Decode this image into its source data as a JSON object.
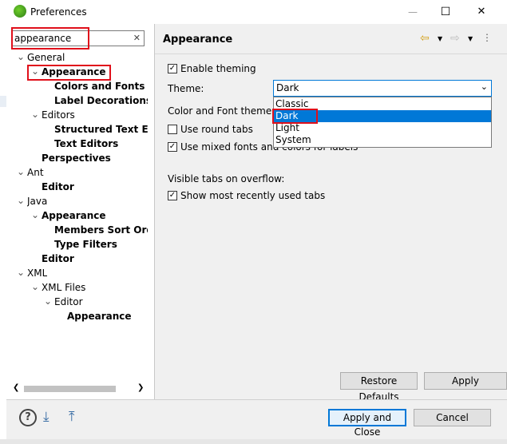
{
  "window": {
    "title": "Preferences",
    "minimize_glyph": "—",
    "maximize_glyph": "☐",
    "close_glyph": "✕",
    "icon": "eclipse-icon"
  },
  "filter": {
    "value": "appearance",
    "clear_glyph": "✕"
  },
  "tree": [
    {
      "label": "General",
      "bold": false
    },
    {
      "label": "Appearance",
      "bold": true
    },
    {
      "label": "Colors and Fonts",
      "bold": true
    },
    {
      "label": "Label Decorations",
      "bold": true
    },
    {
      "label": "Editors",
      "bold": false
    },
    {
      "label": "Structured Text Edi",
      "bold": true
    },
    {
      "label": "Text Editors",
      "bold": true
    },
    {
      "label": "Perspectives",
      "bold": true
    },
    {
      "label": "Ant",
      "bold": false
    },
    {
      "label": "Editor",
      "bold": true
    },
    {
      "label": "Java",
      "bold": false
    },
    {
      "label": "Appearance",
      "bold": true
    },
    {
      "label": "Members Sort Orde",
      "bold": true
    },
    {
      "label": "Type Filters",
      "bold": true
    },
    {
      "label": "Editor",
      "bold": true
    },
    {
      "label": "XML",
      "bold": false
    },
    {
      "label": "XML Files",
      "bold": false
    },
    {
      "label": "Editor",
      "bold": false
    },
    {
      "label": "Appearance",
      "bold": true
    }
  ],
  "page": {
    "title": "Appearance",
    "enable_theming": "Enable theming",
    "theme_label": "Theme:",
    "theme_value": "Dark",
    "color_font_label": "Color and Font theme:",
    "use_round_tabs": "Use round tabs",
    "use_mixed_fonts": "Use mixed fonts and colors for labels",
    "visible_tabs_label": "Visible tabs on overflow:",
    "show_recent_tabs": "Show most recently used tabs",
    "dropdown_options": [
      "Classic",
      "Dark",
      "Light",
      "System"
    ],
    "selected_option": "Dark"
  },
  "buttons": {
    "restore_defaults": "Restore Defaults",
    "apply": "Apply",
    "apply_close": "Apply and Close",
    "cancel": "Cancel"
  },
  "colors": {
    "selection": "#0078d7",
    "highlight": "#e0101b"
  }
}
